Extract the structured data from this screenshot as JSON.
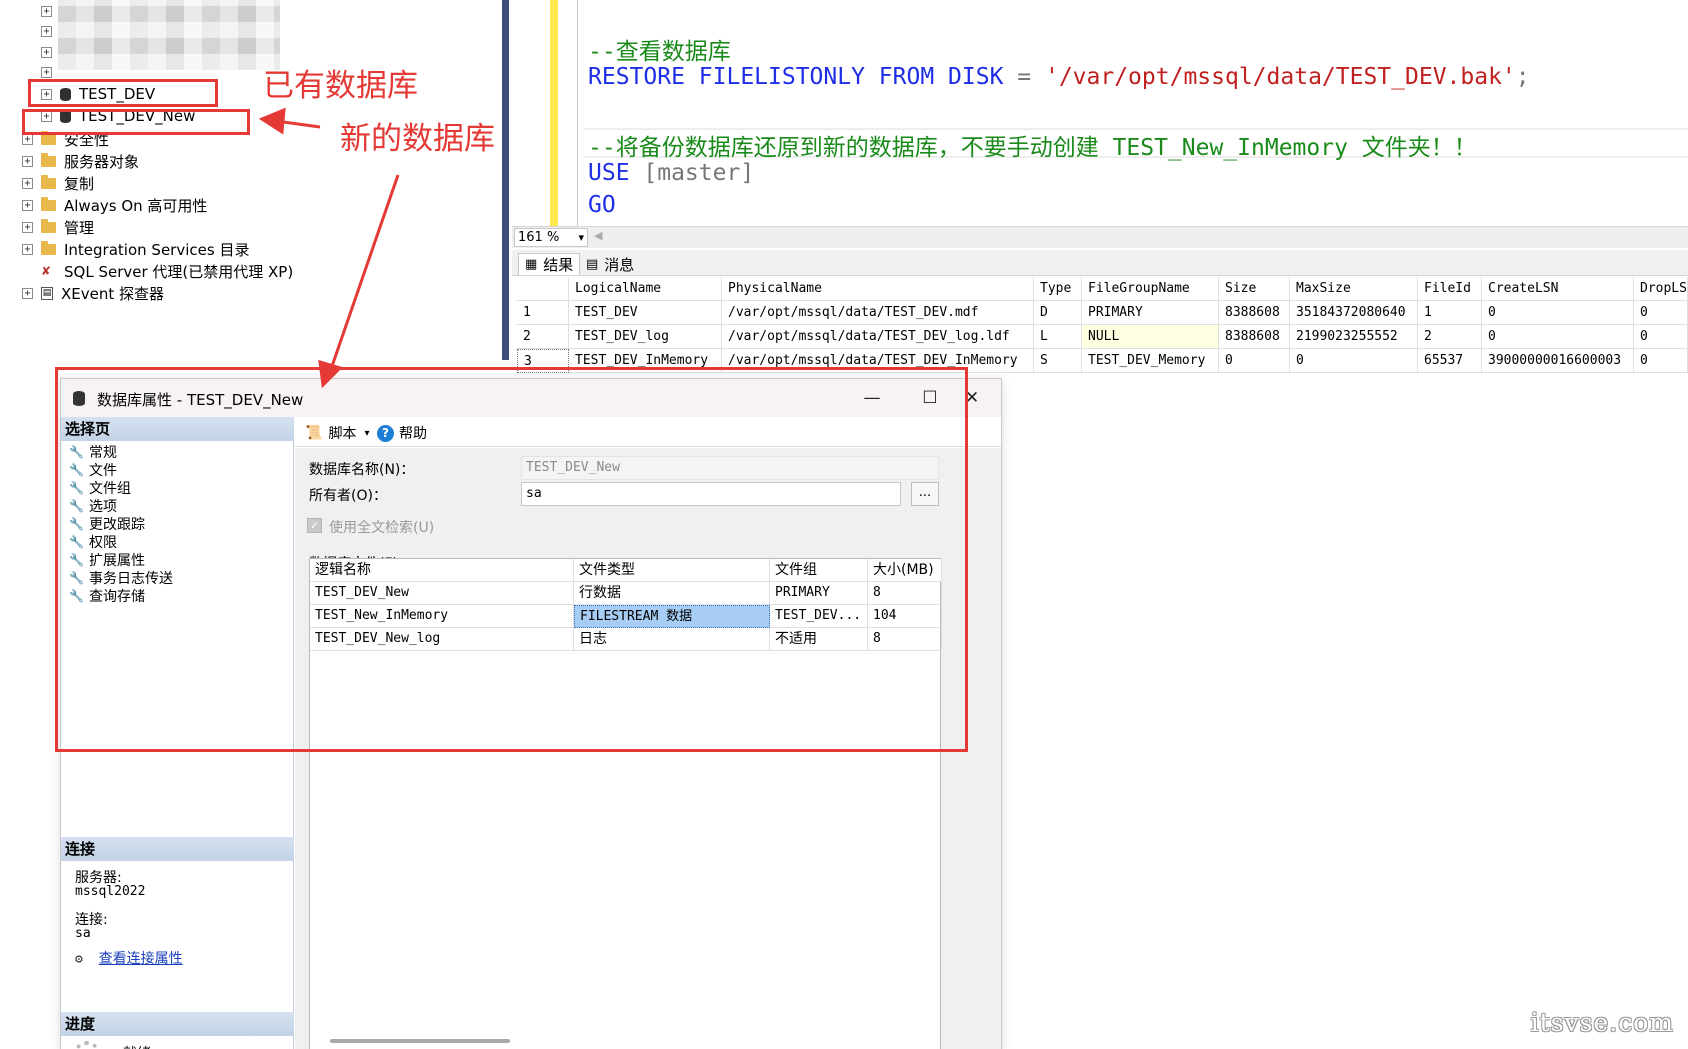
{
  "tree": {
    "items": [
      {
        "label": "TEST_DEV",
        "type": "database"
      },
      {
        "label": "TEST_DEV_New",
        "type": "database"
      },
      {
        "label": "安全性",
        "type": "folder"
      },
      {
        "label": "服务器对象",
        "type": "folder"
      },
      {
        "label": "复制",
        "type": "folder"
      },
      {
        "label": "Always On 高可用性",
        "type": "folder"
      },
      {
        "label": "管理",
        "type": "folder"
      },
      {
        "label": "Integration Services 目录",
        "type": "folder"
      },
      {
        "label": "SQL Server 代理(已禁用代理 XP)",
        "type": "agent"
      },
      {
        "label": "XEvent 探查器",
        "type": "xevent"
      }
    ]
  },
  "annotations": {
    "existing_db": "已有数据库",
    "new_db": "新的数据库"
  },
  "editor": {
    "line1_comment": "--查看数据库",
    "line2_kw": "RESTORE FILELISTONLY FROM DISK",
    "line2_eq": " = ",
    "line2_str": "'/var/opt/mssql/data/TEST_DEV.bak'",
    "line2_end": ";",
    "line3_comment": "--将备份数据库还原到新的数据库，不要手动创建 TEST_New_InMemory 文件夹！！",
    "line4_kw": "USE",
    "line4_rest": " [master]",
    "line5_kw": "GO"
  },
  "zoom": "161 %",
  "result_tabs": {
    "results": "结果",
    "messages": "消息"
  },
  "results": {
    "columns": [
      "",
      "LogicalName",
      "PhysicalName",
      "Type",
      "FileGroupName",
      "Size",
      "MaxSize",
      "FileId",
      "CreateLSN",
      "DropLSN"
    ],
    "rows": [
      [
        "1",
        "TEST_DEV",
        "/var/opt/mssql/data/TEST_DEV.mdf",
        "D",
        "PRIMARY",
        "8388608",
        "35184372080640",
        "1",
        "0",
        "0"
      ],
      [
        "2",
        "TEST_DEV_log",
        "/var/opt/mssql/data/TEST_DEV_log.ldf",
        "L",
        "NULL",
        "8388608",
        "2199023255552",
        "2",
        "0",
        "0"
      ],
      [
        "3",
        "TEST_DEV_InMemory",
        "/var/opt/mssql/data/TEST_DEV_InMemory",
        "S",
        "TEST_DEV_Memory",
        "0",
        "0",
        "65537",
        "39000000016600003",
        "0"
      ]
    ]
  },
  "dialog": {
    "title": "数据库属性 - TEST_DEV_New",
    "select_page": "选择页",
    "pages": [
      "常规",
      "文件",
      "文件组",
      "选项",
      "更改跟踪",
      "权限",
      "扩展属性",
      "事务日志传送",
      "查询存储"
    ],
    "connection_header": "连接",
    "server_label": "服务器:",
    "server_value": "mssql2022",
    "connection_label": "连接:",
    "connection_value": "sa",
    "view_connection": "查看连接属性",
    "progress_header": "进度",
    "progress_status": "就绪",
    "toolbar": {
      "script": "脚本",
      "help": "帮助"
    },
    "db_name_label": "数据库名称(N)：",
    "db_name_value": "TEST_DEV_New",
    "owner_label": "所有者(O)：",
    "owner_value": "sa",
    "browse": "...",
    "fulltext_label": "使用全文检索(U)",
    "files_label": "数据库文件(F)：",
    "file_columns": [
      "逻辑名称",
      "文件类型",
      "文件组",
      "大小(MB)"
    ],
    "files": [
      [
        "TEST_DEV_New",
        "行数据",
        "PRIMARY",
        "8"
      ],
      [
        "TEST_New_InMemory",
        "FILESTREAM 数据",
        "TEST_DEV...",
        "104"
      ],
      [
        "TEST_DEV_New_log",
        "日志",
        "不适用",
        "8"
      ]
    ]
  },
  "watermark": "itsvse.com",
  "colors": {
    "annotation_red": "#e53935",
    "selection": "#a8cdf4",
    "keyword_blue": "#1e2ee6",
    "comment_green": "#1a8a1a"
  }
}
